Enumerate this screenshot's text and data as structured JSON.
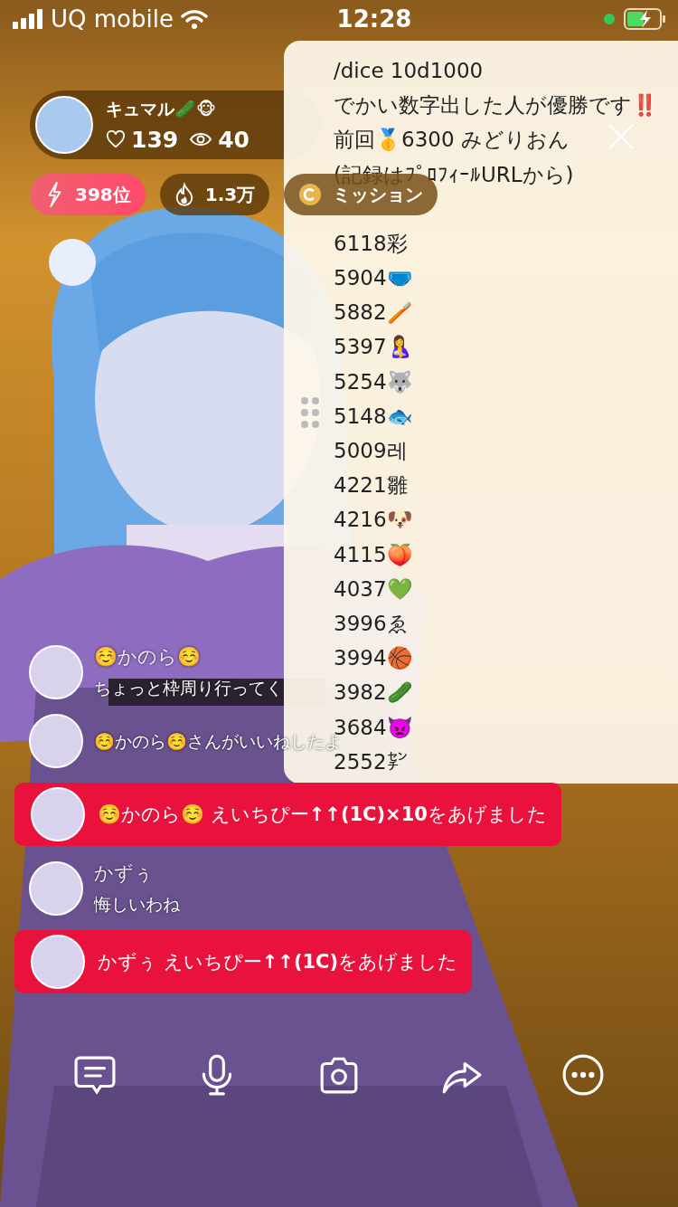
{
  "status_bar": {
    "carrier": "UQ mobile",
    "time": "12:28"
  },
  "streamer": {
    "name": "キュマル🥒🐵",
    "likes": "139",
    "viewers": "40"
  },
  "chips": [
    {
      "kind": "rank",
      "label": "398位"
    },
    {
      "kind": "fire",
      "label": "1.3万"
    },
    {
      "kind": "mission",
      "label": "ミッション"
    }
  ],
  "panel": {
    "lines": [
      "/dice 10d1000",
      "でかい数字出した人が優勝です‼️",
      "前回🥇6300 みどりおん",
      "(記録はﾌﾟﾛﾌｨｰﾙURLから)"
    ],
    "results": [
      "6118彩",
      "5904🩲",
      "5882🪥",
      "5397🤱",
      "5254🐺",
      "5148🐟",
      "5009레",
      "4221雛",
      "4216🐶",
      "4115🍑",
      "4037💚",
      "3996ゑ",
      "3994🏀",
      "3982🥒",
      "3684👿",
      "2552㌢"
    ]
  },
  "chat": [
    {
      "kind": "comment",
      "name": "☺️かのら☺️",
      "message": "ちょっと枠周り行ってく"
    },
    {
      "kind": "notice",
      "message": "☺️かのら☺️さんがいいねしたよ"
    },
    {
      "kind": "gift",
      "message": "☺️かのら☺️ えいちぴー**↑↑(1C)×10**をあげました"
    },
    {
      "kind": "comment",
      "name": "かずぅ",
      "message": "悔しいわね"
    },
    {
      "kind": "gift",
      "message": "かずぅ えいちぴー**↑↑(1C)**をあげました"
    }
  ],
  "toolbar": [
    {
      "kind": "comment"
    },
    {
      "kind": "mic"
    },
    {
      "kind": "camera"
    },
    {
      "kind": "share"
    },
    {
      "kind": "more"
    }
  ]
}
